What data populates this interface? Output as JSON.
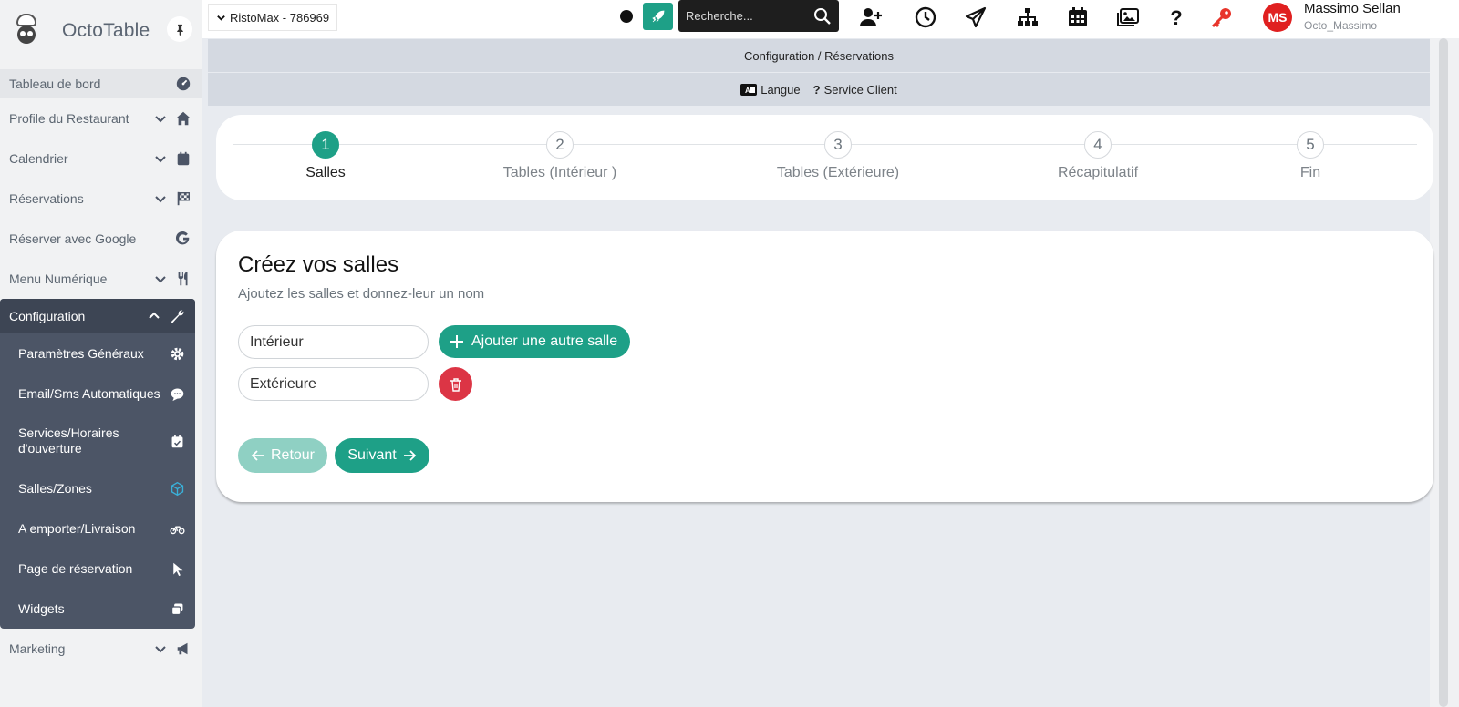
{
  "sidebar": {
    "brand": "OctoTable",
    "items": [
      {
        "label": "Tableau de bord"
      },
      {
        "label": "Profile du Restaurant"
      },
      {
        "label": "Calendrier"
      },
      {
        "label": "Réservations"
      },
      {
        "label": "Réserver avec Google"
      },
      {
        "label": "Menu Numérique"
      }
    ],
    "config": {
      "label": "Configuration",
      "items": [
        {
          "label": "Paramètres Généraux"
        },
        {
          "label": "Email/Sms Automatiques"
        },
        {
          "label": "Services/Horaires d'ouverture"
        },
        {
          "label": "Salles/Zones"
        },
        {
          "label": "A emporter/Livraison"
        },
        {
          "label": "Page de réservation"
        },
        {
          "label": "Widgets"
        }
      ]
    },
    "marketing": {
      "label": "Marketing"
    }
  },
  "topbar": {
    "restaurant": "RistoMax - 786969",
    "search_placeholder": "Recherche...",
    "user": {
      "initials": "MS",
      "name": "Massimo Sellan",
      "handle": "Octo_Massimo"
    }
  },
  "breadcrumb": "Configuration / Réservations",
  "links": {
    "language": "Langue",
    "support": "Service Client"
  },
  "stepper": [
    {
      "num": "1",
      "label": "Salles"
    },
    {
      "num": "2",
      "label": "Tables (Intérieur )"
    },
    {
      "num": "3",
      "label": "Tables (Extérieure)"
    },
    {
      "num": "4",
      "label": "Récapitulatif"
    },
    {
      "num": "5",
      "label": "Fin"
    }
  ],
  "card": {
    "title": "Créez vos salles",
    "subtitle": "Ajoutez les salles et donnez-leur un nom",
    "rooms": [
      "Intérieur",
      "Extérieure"
    ],
    "add_label": "Ajouter une autre salle",
    "back_label": "Retour",
    "next_label": "Suivant"
  },
  "colors": {
    "accent": "#1ea087",
    "danger": "#dc3545",
    "sidebar_dark": "#4c5566"
  }
}
